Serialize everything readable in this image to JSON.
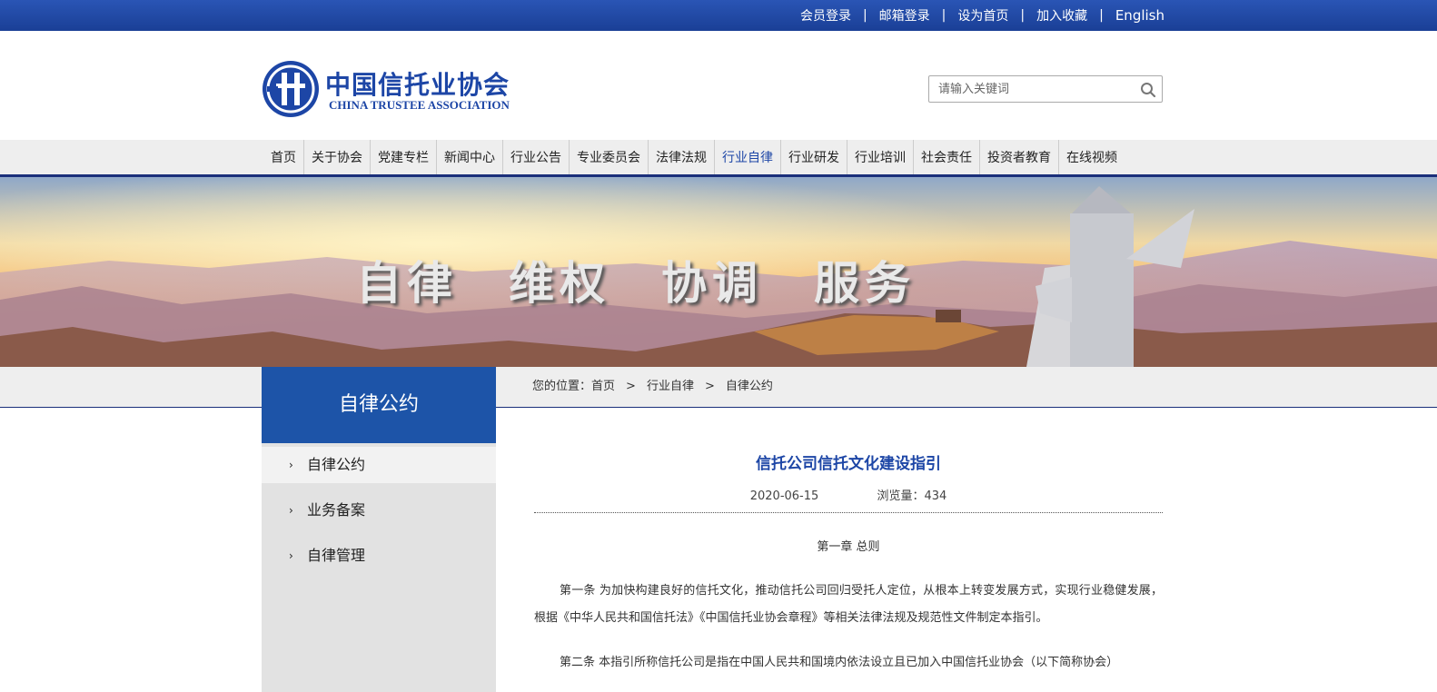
{
  "top_links": [
    "会员登录",
    "邮箱登录",
    "设为首页",
    "加入收藏",
    "English"
  ],
  "top_sep": "|",
  "logo": {
    "cn": "中国信托业协会",
    "en": "CHINA TRUSTEE ASSOCIATION"
  },
  "search": {
    "placeholder": "请输入关键词",
    "icon": "search-icon"
  },
  "nav": [
    "首页",
    "关于协会",
    "党建专栏",
    "新闻中心",
    "行业公告",
    "专业委员会",
    "法律法规",
    "行业自律",
    "行业研发",
    "行业培训",
    "社会责任",
    "投资者教育",
    "在线视频"
  ],
  "nav_active": "行业自律",
  "banner": {
    "slogan": "自律　维权　协调　服务"
  },
  "breadcrumb": {
    "prefix": "您的位置：",
    "items": [
      "首页",
      "行业自律",
      "自律公约"
    ],
    "sep": ">"
  },
  "sidebar": {
    "title": "自律公约",
    "items": [
      "自律公约",
      "业务备案",
      "自律管理"
    ],
    "active": "自律公约",
    "arrow": "›"
  },
  "article": {
    "title": "信托公司信托文化建设指引",
    "date": "2020-06-15",
    "views": "浏览量：434",
    "chapter": "第一章 总则",
    "para1": "第一条 为加快构建良好的信托文化，推动信托公司回归受托人定位，从根本上转变发展方式，实现行业稳健发展，根据《中华人民共和国信托法》《中国信托业协会章程》等相关法律法规及规范性文件制定本指引。",
    "para2": "第二条 本指引所称信托公司是指在中国人民共和国境内依法设立且已加入中国信托业协会（以下简称协会）"
  },
  "colors": {
    "brand_blue": "#1d46a6",
    "sidebar_head": "#1d54a8",
    "nav_line": "#1a2f7a"
  }
}
